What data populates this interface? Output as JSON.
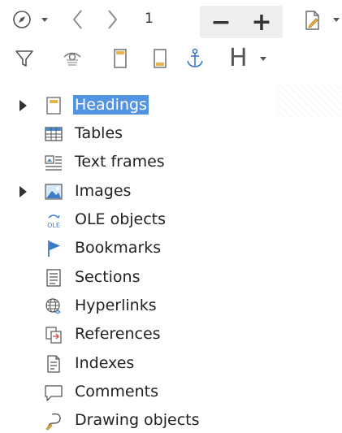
{
  "toolbar": {
    "page_number": "1",
    "zoom_out_label": "−",
    "zoom_in_label": "+",
    "heading_level_label": "H"
  },
  "icons": {
    "navigate": "compass-icon",
    "previous": "chevron-left-icon",
    "next": "chevron-right-icon",
    "drag_mode": "document-edit-icon",
    "filter": "filter-icon",
    "show_tracked": "eye-doc-icon",
    "header": "page-header-icon",
    "footer": "page-footer-icon",
    "anchor": "anchor-icon"
  },
  "tree": {
    "items": [
      {
        "label": "Headings",
        "icon": "headings-icon",
        "expandable": true,
        "selected": true
      },
      {
        "label": "Tables",
        "icon": "table-icon",
        "expandable": false,
        "selected": false
      },
      {
        "label": "Text frames",
        "icon": "text-frame-icon",
        "expandable": false,
        "selected": false
      },
      {
        "label": "Images",
        "icon": "image-icon",
        "expandable": true,
        "selected": false
      },
      {
        "label": "OLE objects",
        "icon": "ole-icon",
        "expandable": false,
        "selected": false
      },
      {
        "label": "Bookmarks",
        "icon": "bookmark-icon",
        "expandable": false,
        "selected": false
      },
      {
        "label": "Sections",
        "icon": "section-icon",
        "expandable": false,
        "selected": false
      },
      {
        "label": "Hyperlinks",
        "icon": "hyperlink-icon",
        "expandable": false,
        "selected": false
      },
      {
        "label": "References",
        "icon": "reference-icon",
        "expandable": false,
        "selected": false
      },
      {
        "label": "Indexes",
        "icon": "index-icon",
        "expandable": false,
        "selected": false
      },
      {
        "label": "Comments",
        "icon": "comment-icon",
        "expandable": false,
        "selected": false
      },
      {
        "label": "Drawing objects",
        "icon": "drawing-icon",
        "expandable": false,
        "selected": false
      }
    ]
  },
  "colors": {
    "selection": "#5294e2",
    "text": "#222222",
    "icon_stroke": "#555555"
  }
}
